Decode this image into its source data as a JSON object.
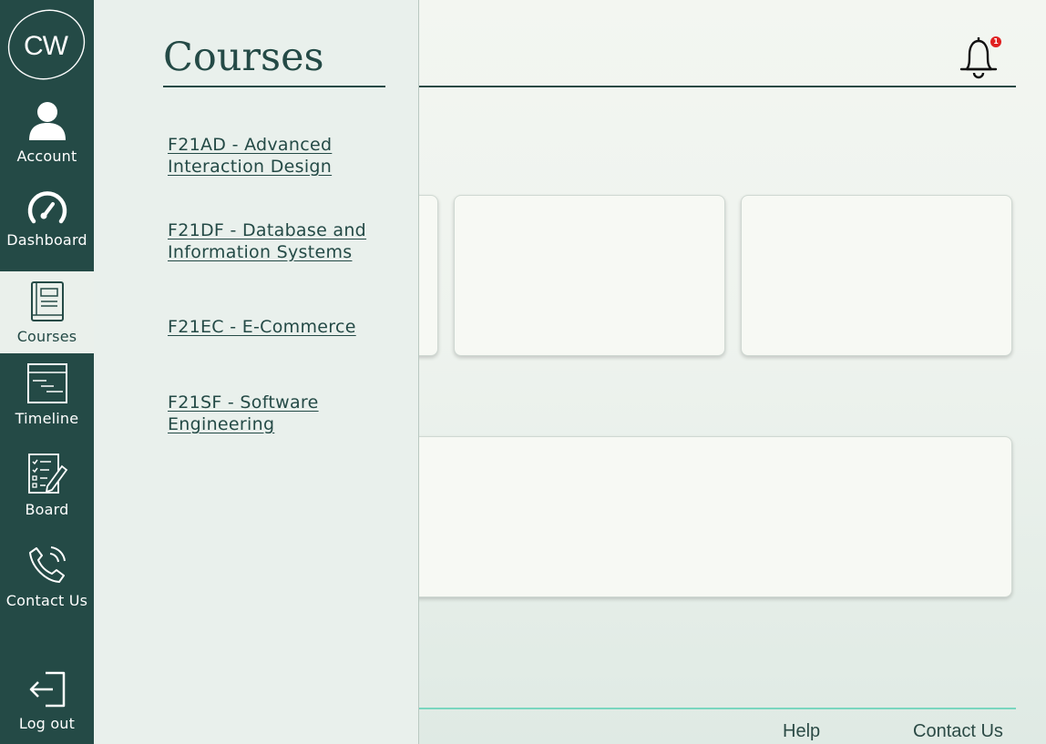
{
  "logo": {
    "text": "CW"
  },
  "sidebar": {
    "items": [
      {
        "label": "Account",
        "icon": "user-icon"
      },
      {
        "label": "Dashboard",
        "icon": "gauge-icon"
      },
      {
        "label": "Courses",
        "icon": "book-icon",
        "active": true
      },
      {
        "label": "Timeline",
        "icon": "timeline-icon"
      },
      {
        "label": "Board",
        "icon": "checklist-pen-icon"
      },
      {
        "label": "Contact Us",
        "icon": "phone-icon"
      }
    ],
    "logout": {
      "label": "Log out",
      "icon": "logout-icon"
    }
  },
  "flyout": {
    "title": "Courses",
    "courses": [
      "F21AD - Advanced Interaction Design",
      "F21DF - Database and Information Systems",
      "F21EC - E-Commerce",
      "F21SF - Software Engineering"
    ]
  },
  "header": {
    "notifications": {
      "icon": "bell-icon",
      "count": "1",
      "badge_color": "#e02020"
    }
  },
  "footer": {
    "help_label": "Help",
    "contact_label": "Contact Us"
  },
  "colors": {
    "sidebar_bg": "#244a46",
    "accent_line": "#79d6bf",
    "panel_bg": "#e9f0ec"
  }
}
